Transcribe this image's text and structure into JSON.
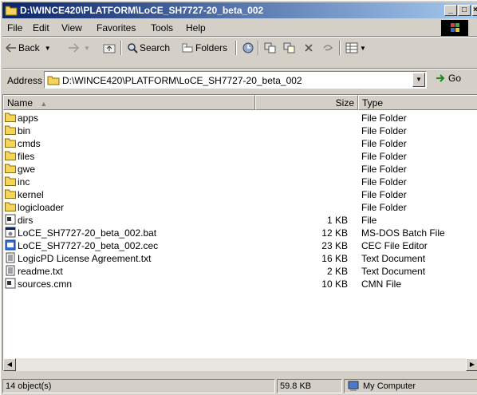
{
  "window": {
    "title": "D:\\WINCE420\\PLATFORM\\LoCE_SH7727-20_beta_002",
    "minimize": "_",
    "maximize": "□",
    "close": "×"
  },
  "menu": [
    "File",
    "Edit",
    "View",
    "Favorites",
    "Tools",
    "Help"
  ],
  "toolbar": {
    "back": "Back",
    "search": "Search",
    "folders": "Folders"
  },
  "address": {
    "label": "Address",
    "value": "D:\\WINCE420\\PLATFORM\\LoCE_SH7727-20_beta_002",
    "go": "Go"
  },
  "columns": {
    "name": "Name",
    "size": "Size",
    "type": "Type"
  },
  "files": [
    {
      "name": "apps",
      "size": "",
      "type": "File Folder",
      "icon": "folder-icon"
    },
    {
      "name": "bin",
      "size": "",
      "type": "File Folder",
      "icon": "folder-icon"
    },
    {
      "name": "cmds",
      "size": "",
      "type": "File Folder",
      "icon": "folder-icon"
    },
    {
      "name": "files",
      "size": "",
      "type": "File Folder",
      "icon": "folder-icon"
    },
    {
      "name": "gwe",
      "size": "",
      "type": "File Folder",
      "icon": "folder-icon"
    },
    {
      "name": "inc",
      "size": "",
      "type": "File Folder",
      "icon": "folder-icon"
    },
    {
      "name": "kernel",
      "size": "",
      "type": "File Folder",
      "icon": "folder-icon"
    },
    {
      "name": "logicloader",
      "size": "",
      "type": "File Folder",
      "icon": "folder-icon"
    },
    {
      "name": "dirs",
      "size": "1 KB",
      "type": "File",
      "icon": "generic-file-icon"
    },
    {
      "name": "LoCE_SH7727-20_beta_002.bat",
      "size": "12 KB",
      "type": "MS-DOS Batch File",
      "icon": "batch-file-icon"
    },
    {
      "name": "LoCE_SH7727-20_beta_002.cec",
      "size": "23 KB",
      "type": "CEC File Editor",
      "icon": "cec-file-icon"
    },
    {
      "name": "LogicPD License Agreement.txt",
      "size": "16 KB",
      "type": "Text Document",
      "icon": "text-file-icon"
    },
    {
      "name": "readme.txt",
      "size": "2 KB",
      "type": "Text Document",
      "icon": "text-file-icon"
    },
    {
      "name": "sources.cmn",
      "size": "10 KB",
      "type": "CMN File",
      "icon": "generic-file-icon"
    }
  ],
  "status": {
    "objects": "14 object(s)",
    "size": "59.8 KB",
    "zone": "My Computer"
  }
}
